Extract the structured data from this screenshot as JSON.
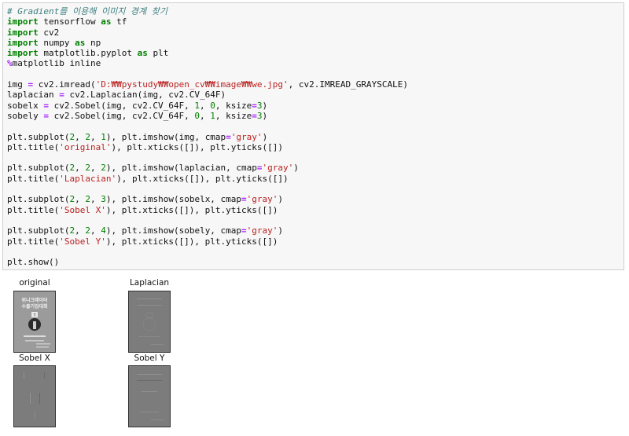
{
  "code_cell": {
    "lines": [
      [
        {
          "t": "# Gradient를 이용해 이미지 경계 찾기",
          "c": "c"
        }
      ],
      [
        {
          "t": "import",
          "c": "k"
        },
        {
          "t": " tensorflow "
        },
        {
          "t": "as",
          "c": "k"
        },
        {
          "t": " tf"
        }
      ],
      [
        {
          "t": "import",
          "c": "k"
        },
        {
          "t": " cv2"
        }
      ],
      [
        {
          "t": "import",
          "c": "k"
        },
        {
          "t": " numpy "
        },
        {
          "t": "as",
          "c": "k"
        },
        {
          "t": " np"
        }
      ],
      [
        {
          "t": "import",
          "c": "k"
        },
        {
          "t": " matplotlib.pyplot "
        },
        {
          "t": "as",
          "c": "k"
        },
        {
          "t": " plt"
        }
      ],
      [
        {
          "t": "%",
          "c": "m"
        },
        {
          "t": "matplotlib inline"
        }
      ],
      [],
      [
        {
          "t": "img "
        },
        {
          "t": "=",
          "c": "o"
        },
        {
          "t": " cv2.imread("
        },
        {
          "t": "'D:₩₩pystudy₩₩open_cv₩₩image₩₩we.jpg'",
          "c": "s"
        },
        {
          "t": ", cv2.IMREAD_GRAYSCALE)"
        }
      ],
      [
        {
          "t": "laplacian "
        },
        {
          "t": "=",
          "c": "o"
        },
        {
          "t": " cv2.Laplacian(img, cv2.CV_64F)"
        }
      ],
      [
        {
          "t": "sobelx "
        },
        {
          "t": "=",
          "c": "o"
        },
        {
          "t": " cv2.Sobel(img, cv2.CV_64F, "
        },
        {
          "t": "1",
          "c": "n"
        },
        {
          "t": ", "
        },
        {
          "t": "0",
          "c": "n"
        },
        {
          "t": ", ksize"
        },
        {
          "t": "=",
          "c": "o"
        },
        {
          "t": "3",
          "c": "n"
        },
        {
          "t": ")"
        }
      ],
      [
        {
          "t": "sobely "
        },
        {
          "t": "=",
          "c": "o"
        },
        {
          "t": " cv2.Sobel(img, cv2.CV_64F, "
        },
        {
          "t": "0",
          "c": "n"
        },
        {
          "t": ", "
        },
        {
          "t": "1",
          "c": "n"
        },
        {
          "t": ", ksize"
        },
        {
          "t": "=",
          "c": "o"
        },
        {
          "t": "3",
          "c": "n"
        },
        {
          "t": ")"
        }
      ],
      [],
      [
        {
          "t": "plt.subplot("
        },
        {
          "t": "2",
          "c": "n"
        },
        {
          "t": ", "
        },
        {
          "t": "2",
          "c": "n"
        },
        {
          "t": ", "
        },
        {
          "t": "1",
          "c": "n"
        },
        {
          "t": "), plt.imshow(img, cmap"
        },
        {
          "t": "=",
          "c": "o"
        },
        {
          "t": "'gray'",
          "c": "s"
        },
        {
          "t": ")"
        }
      ],
      [
        {
          "t": "plt.title("
        },
        {
          "t": "'original'",
          "c": "s"
        },
        {
          "t": "), plt.xticks([]), plt.yticks([])"
        }
      ],
      [],
      [
        {
          "t": "plt.subplot("
        },
        {
          "t": "2",
          "c": "n"
        },
        {
          "t": ", "
        },
        {
          "t": "2",
          "c": "n"
        },
        {
          "t": ", "
        },
        {
          "t": "2",
          "c": "n"
        },
        {
          "t": "), plt.imshow(laplacian, cmap"
        },
        {
          "t": "=",
          "c": "o"
        },
        {
          "t": "'gray'",
          "c": "s"
        },
        {
          "t": ")"
        }
      ],
      [
        {
          "t": "plt.title("
        },
        {
          "t": "'Laplacian'",
          "c": "s"
        },
        {
          "t": "), plt.xticks([]), plt.yticks([])"
        }
      ],
      [],
      [
        {
          "t": "plt.subplot("
        },
        {
          "t": "2",
          "c": "n"
        },
        {
          "t": ", "
        },
        {
          "t": "2",
          "c": "n"
        },
        {
          "t": ", "
        },
        {
          "t": "3",
          "c": "n"
        },
        {
          "t": "), plt.imshow(sobelx, cmap"
        },
        {
          "t": "=",
          "c": "o"
        },
        {
          "t": "'gray'",
          "c": "s"
        },
        {
          "t": ")"
        }
      ],
      [
        {
          "t": "plt.title("
        },
        {
          "t": "'Sobel X'",
          "c": "s"
        },
        {
          "t": "), plt.xticks([]), plt.yticks([])"
        }
      ],
      [],
      [
        {
          "t": "plt.subplot("
        },
        {
          "t": "2",
          "c": "n"
        },
        {
          "t": ", "
        },
        {
          "t": "2",
          "c": "n"
        },
        {
          "t": ", "
        },
        {
          "t": "4",
          "c": "n"
        },
        {
          "t": "), plt.imshow(sobely, cmap"
        },
        {
          "t": "=",
          "c": "o"
        },
        {
          "t": "'gray'",
          "c": "s"
        },
        {
          "t": ")"
        }
      ],
      [
        {
          "t": "plt.title("
        },
        {
          "t": "'Sobel Y'",
          "c": "s"
        },
        {
          "t": "), plt.xticks([]), plt.yticks([])"
        }
      ],
      [],
      [
        {
          "t": "plt.show()"
        }
      ]
    ]
  },
  "output": {
    "plots": [
      {
        "title": "original"
      },
      {
        "title": "Laplacian"
      },
      {
        "title": "Sobel X"
      },
      {
        "title": "Sobel Y"
      }
    ],
    "original_image_text": [
      "위니크레이터",
      "수출기업대회",
      "7"
    ]
  },
  "colors": {
    "cell_bg": "#f7f7f7",
    "keyword": "#008000",
    "string": "#ba2121",
    "comment": "#408080",
    "operator": "#aa22ff"
  }
}
